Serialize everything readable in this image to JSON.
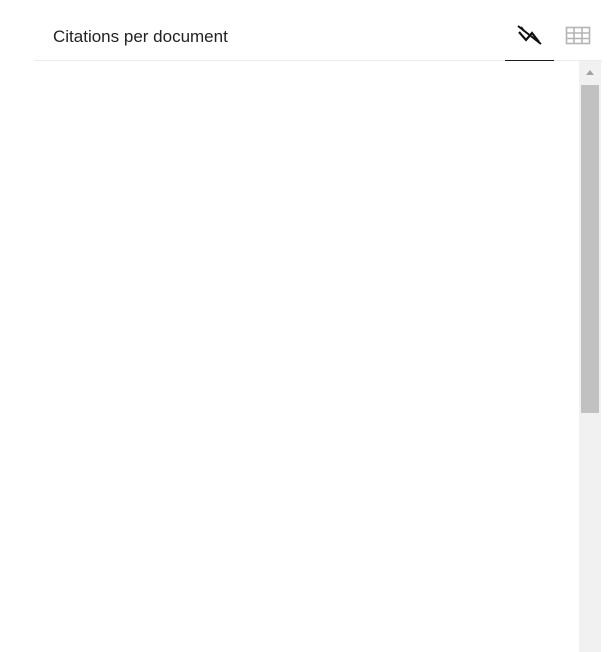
{
  "panel": {
    "title": "Citations per document",
    "views": [
      {
        "name": "chart-view",
        "icon": "line-chart-off-icon",
        "active": true
      },
      {
        "name": "table-view",
        "icon": "table-grid-icon",
        "active": false
      }
    ]
  },
  "colors": {
    "title_text": "#222222",
    "active_underline": "#1a1a1a",
    "inactive_icon": "#b5b5b5",
    "scrollbar_track": "#f1f1f1",
    "scrollbar_thumb": "#c1c1c1"
  }
}
